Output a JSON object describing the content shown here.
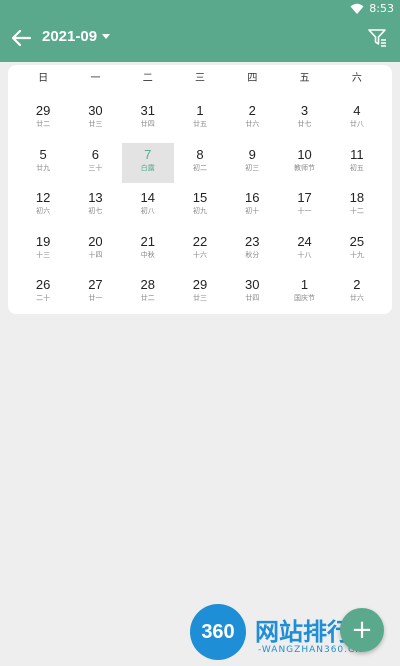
{
  "status_bar": {
    "time": "8:53"
  },
  "header": {
    "title": "2021-09"
  },
  "calendar": {
    "weekdays": [
      "日",
      "一",
      "二",
      "三",
      "四",
      "五",
      "六"
    ],
    "weeks": [
      [
        {
          "day": "29",
          "lunar": "廿二"
        },
        {
          "day": "30",
          "lunar": "廿三"
        },
        {
          "day": "31",
          "lunar": "廿四"
        },
        {
          "day": "1",
          "lunar": "廿五"
        },
        {
          "day": "2",
          "lunar": "廿六"
        },
        {
          "day": "3",
          "lunar": "廿七"
        },
        {
          "day": "4",
          "lunar": "廿八"
        }
      ],
      [
        {
          "day": "5",
          "lunar": "廿九"
        },
        {
          "day": "6",
          "lunar": "三十"
        },
        {
          "day": "7",
          "lunar": "白露"
        },
        {
          "day": "8",
          "lunar": "初二"
        },
        {
          "day": "9",
          "lunar": "初三"
        },
        {
          "day": "10",
          "lunar": "教师节"
        },
        {
          "day": "11",
          "lunar": "初五"
        }
      ],
      [
        {
          "day": "12",
          "lunar": "初六"
        },
        {
          "day": "13",
          "lunar": "初七"
        },
        {
          "day": "14",
          "lunar": "初八"
        },
        {
          "day": "15",
          "lunar": "初九"
        },
        {
          "day": "16",
          "lunar": "初十"
        },
        {
          "day": "17",
          "lunar": "十一"
        },
        {
          "day": "18",
          "lunar": "十二"
        }
      ],
      [
        {
          "day": "19",
          "lunar": "十三"
        },
        {
          "day": "20",
          "lunar": "十四"
        },
        {
          "day": "21",
          "lunar": "中秋"
        },
        {
          "day": "22",
          "lunar": "十六"
        },
        {
          "day": "23",
          "lunar": "秋分"
        },
        {
          "day": "24",
          "lunar": "十八"
        },
        {
          "day": "25",
          "lunar": "十九"
        }
      ],
      [
        {
          "day": "26",
          "lunar": "二十"
        },
        {
          "day": "27",
          "lunar": "廿一"
        },
        {
          "day": "28",
          "lunar": "廿二"
        },
        {
          "day": "29",
          "lunar": "廿三"
        },
        {
          "day": "30",
          "lunar": "廿四"
        },
        {
          "day": "1",
          "lunar": "国庆节"
        },
        {
          "day": "2",
          "lunar": "廿六"
        }
      ]
    ],
    "selected": "7"
  },
  "watermark": {
    "logo": "360",
    "text": "网站排行榜",
    "sub": "-WANGZHAN360.CN-"
  },
  "fab": {
    "label": "+"
  },
  "colors": {
    "accent": "#5aa98c",
    "watermark": "#1e8fd6"
  }
}
